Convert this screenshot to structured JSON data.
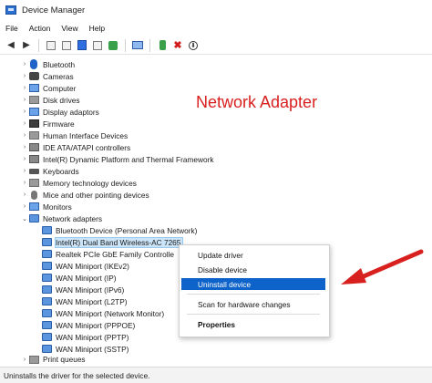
{
  "window": {
    "title": "Device Manager"
  },
  "menu": [
    "File",
    "Action",
    "View",
    "Help"
  ],
  "toolbar": {
    "icons": [
      "back-arrow-icon",
      "forward-arrow-icon",
      "properties-icon",
      "list-icon",
      "help-icon",
      "view-icon",
      "update-icon",
      "monitor-icon",
      "enable-icon",
      "uninstall-icon",
      "download-icon"
    ]
  },
  "tree": {
    "categories": [
      {
        "label": "Bluetooth",
        "icon": "bluetooth-icon"
      },
      {
        "label": "Cameras",
        "icon": "camera-icon"
      },
      {
        "label": "Computer",
        "icon": "computer-icon"
      },
      {
        "label": "Disk drives",
        "icon": "disk-icon"
      },
      {
        "label": "Display adaptors",
        "icon": "display-icon"
      },
      {
        "label": "Firmware",
        "icon": "firmware-icon"
      },
      {
        "label": "Human Interface Devices",
        "icon": "hid-icon"
      },
      {
        "label": "IDE ATA/ATAPI controllers",
        "icon": "ide-icon"
      },
      {
        "label": "Intel(R) Dynamic Platform and Thermal Framework",
        "icon": "chip-icon"
      },
      {
        "label": "Keyboards",
        "icon": "keyboard-icon"
      },
      {
        "label": "Memory technology devices",
        "icon": "memory-icon"
      },
      {
        "label": "Mice and other pointing devices",
        "icon": "mouse-icon"
      },
      {
        "label": "Monitors",
        "icon": "monitor-icon"
      },
      {
        "label": "Network adapters",
        "icon": "network-icon"
      }
    ],
    "network_children": [
      "Bluetooth Device (Personal Area Network)",
      "Intel(R) Dual Band Wireless-AC 7265",
      "Realtek PCIe GbE Family Controlle",
      "WAN Miniport (IKEv2)",
      "WAN Miniport (IP)",
      "WAN Miniport (IPv6)",
      "WAN Miniport (L2TP)",
      "WAN Miniport (Network Monitor)",
      "WAN Miniport (PPPOE)",
      "WAN Miniport (PPTP)",
      "WAN Miniport (SSTP)"
    ],
    "partial_next": "Print queues"
  },
  "annotation": {
    "text": "Network Adapter",
    "color": "#d8211f"
  },
  "context_menu": {
    "update": "Update driver",
    "disable": "Disable device",
    "uninstall": "Uninstall device",
    "scan": "Scan for hardware changes",
    "properties": "Properties"
  },
  "status": {
    "text": "Uninstalls the driver for the selected device."
  },
  "colors": {
    "highlight": "#0d63c9",
    "selection": "#cce4f7",
    "arrow": "#d8211f"
  }
}
